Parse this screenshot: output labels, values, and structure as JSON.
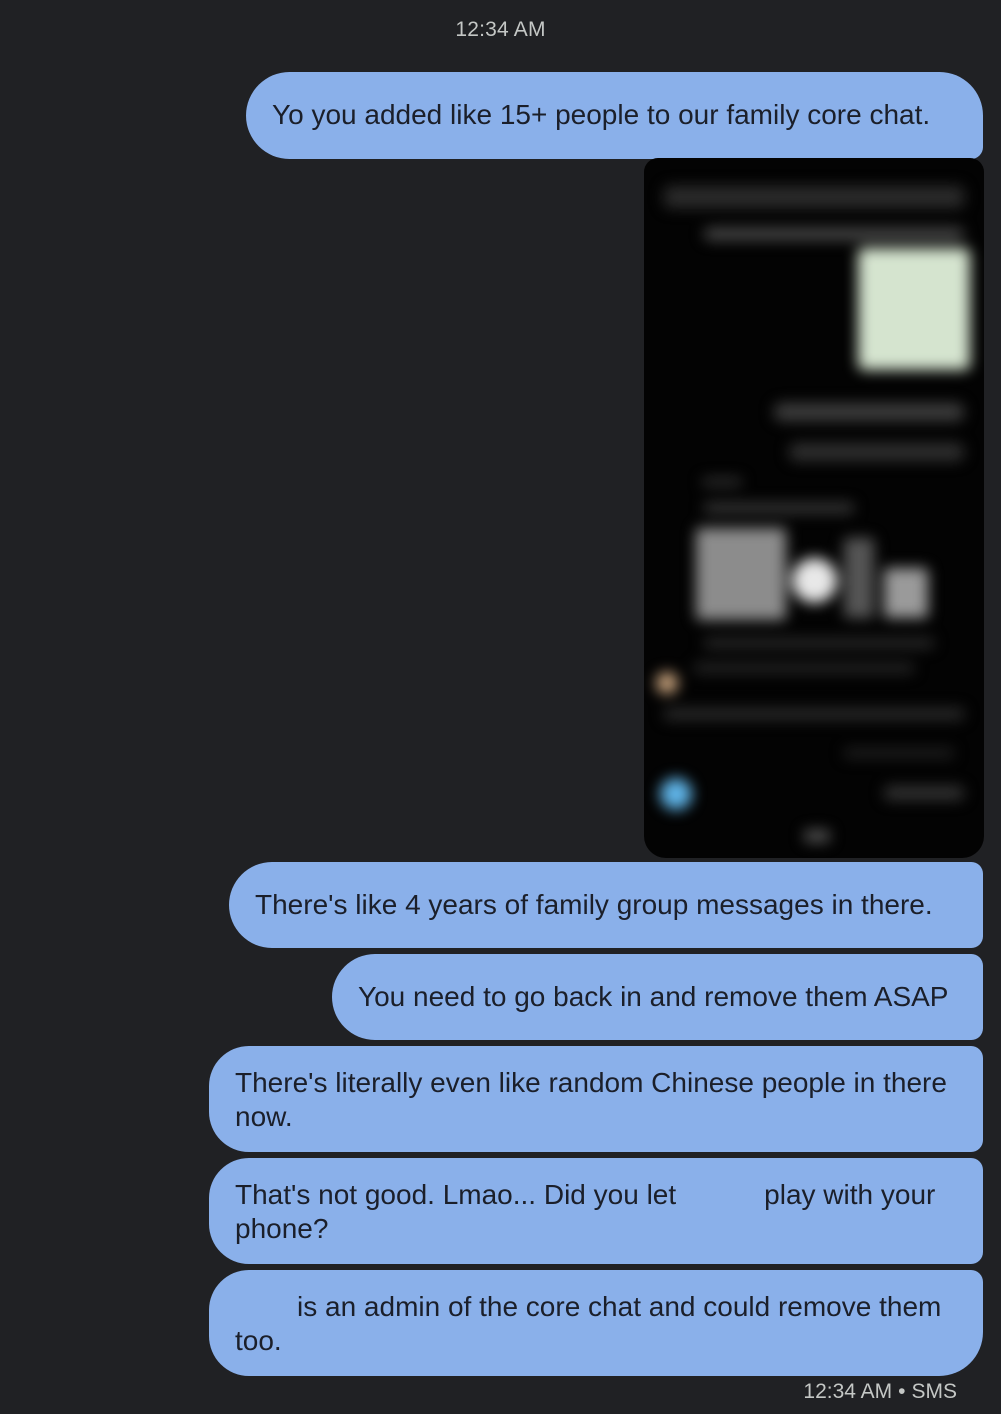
{
  "header": {
    "time": "12:34 AM"
  },
  "messages": [
    {
      "text": "Yo you added like 15+ people to our family core chat."
    },
    {
      "type": "image",
      "icon": "blurred-screenshot"
    },
    {
      "text": "There's like 4 years of family group messages in there."
    },
    {
      "text": "You need to go back in and remove them ASAP"
    },
    {
      "text": "There's literally even like random Chinese people in there now."
    },
    {
      "text_before": "That's not good. Lmao... Did you let",
      "text_after": "play with your phone?"
    },
    {
      "text_after": "is an admin of the core chat and could remove them too."
    }
  ],
  "footer": {
    "time": "12:34 AM",
    "separator": "•",
    "channel": "SMS"
  },
  "colors": {
    "background": "#202124",
    "bubble": "#8ab0ea",
    "bubble_text": "#1b1f2a",
    "meta_text": "#c4c7c5"
  }
}
